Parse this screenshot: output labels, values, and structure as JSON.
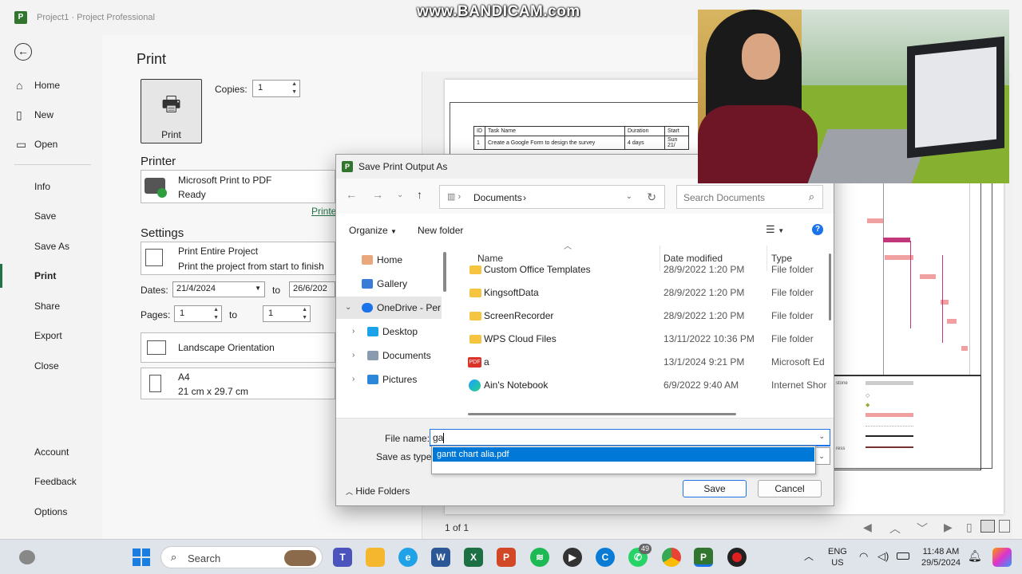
{
  "titlebar": {
    "app_icon": "P",
    "breadcrumb": "Project1  ·  Project Professional"
  },
  "watermark": "www.BANDICAM.com",
  "nav": {
    "items": [
      {
        "label": "Home",
        "icon": "home-icon"
      },
      {
        "label": "New",
        "icon": "new-doc-icon"
      },
      {
        "label": "Open",
        "icon": "folder-open-icon"
      },
      {
        "label": "Info"
      },
      {
        "label": "Save"
      },
      {
        "label": "Save As"
      },
      {
        "label": "Print"
      },
      {
        "label": "Share"
      },
      {
        "label": "Export"
      },
      {
        "label": "Close"
      },
      {
        "label": "Account"
      },
      {
        "label": "Feedback"
      },
      {
        "label": "Options"
      }
    ]
  },
  "print": {
    "heading": "Print",
    "button_label": "Print",
    "copies_label": "Copies:",
    "copies_value": "1",
    "printer_heading": "Printer",
    "printer_name": "Microsoft Print to PDF",
    "printer_status": "Ready",
    "printer_props_link": "Printe",
    "settings_heading": "Settings",
    "scope_title": "Print Entire Project",
    "scope_desc": "Print the project from start to finish",
    "dates_label": "Dates:",
    "date_from": "21/4/2024",
    "date_to_label": "to",
    "date_to": "26/6/202",
    "pages_label": "Pages:",
    "page_from": "1",
    "pages_to_label": "to",
    "page_to": "1",
    "orientation": "Landscape Orientation",
    "paper_name": "A4",
    "paper_size": "21 cm x 29.7 cm"
  },
  "preview": {
    "table_headers": [
      "ID",
      "Task Name",
      "Duration",
      "Start"
    ],
    "table_row": [
      "1",
      "Create a Google Form to design the survey",
      "4 days",
      "Sun 21/"
    ],
    "legend_labels": [
      "stone",
      "ress"
    ],
    "page_indicator": "1 of 1"
  },
  "dialog": {
    "title": "Save Print Output As",
    "address": "Documents",
    "search_placeholder": "Search Documents",
    "organize": "Organize",
    "new_folder": "New folder",
    "help": "?",
    "tree": [
      {
        "label": "Home"
      },
      {
        "label": "Gallery"
      },
      {
        "label": "OneDrive - Perso"
      },
      {
        "label": "Desktop"
      },
      {
        "label": "Documents"
      },
      {
        "label": "Pictures"
      }
    ],
    "columns": [
      "Name",
      "Date modified",
      "Type"
    ],
    "files": [
      {
        "name": "Custom Office Templates",
        "date": "28/9/2022 1:20 PM",
        "type": "File folder",
        "kind": "folder"
      },
      {
        "name": "KingsoftData",
        "date": "28/9/2022 1:20 PM",
        "type": "File folder",
        "kind": "folder"
      },
      {
        "name": "ScreenRecorder",
        "date": "28/9/2022 1:20 PM",
        "type": "File folder",
        "kind": "folder"
      },
      {
        "name": "WPS Cloud Files",
        "date": "13/11/2022 10:36 PM",
        "type": "File folder",
        "kind": "folder"
      },
      {
        "name": "a",
        "date": "13/1/2024 9:21 PM",
        "type": "Microsoft Ed",
        "kind": "pdf"
      },
      {
        "name": "Ain's Notebook",
        "date": "6/9/2022 9:40 AM",
        "type": "Internet Shor",
        "kind": "edge"
      }
    ],
    "filename_label": "File name:",
    "filename_value": "ga",
    "savetype_label": "Save as type:",
    "suggestion": "gantt chart alia.pdf",
    "hide_folders": "Hide Folders",
    "save": "Save",
    "cancel": "Cancel"
  },
  "taskbar": {
    "search_label": "Search",
    "whatsapp_badge": "49",
    "lang_top": "ENG",
    "lang_bottom": "US",
    "time": "11:48 AM",
    "date": "29/5/2024"
  }
}
